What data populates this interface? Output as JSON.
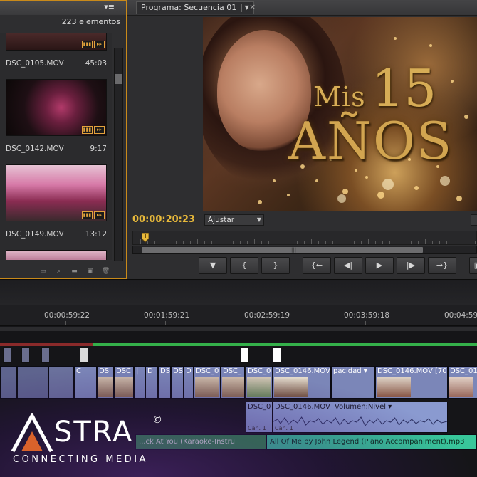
{
  "project_panel": {
    "menu_icon": "panel-menu-icon",
    "item_count": "223 elementos",
    "clips": [
      {
        "name": "DSC_0105.MOV",
        "duration": "45:03"
      },
      {
        "name": "DSC_0142.MOV",
        "duration": "9:17"
      },
      {
        "name": "DSC_0149.MOV",
        "duration": "13:12"
      }
    ],
    "footer_icons": [
      "list-view-icon",
      "search-icon",
      "new-bin-icon",
      "new-item-icon",
      "delete-icon"
    ]
  },
  "program_monitor": {
    "tab_label": "Programa: Secuencia 01",
    "close_glyph": "×",
    "viewer_title": {
      "line1_word": "Mis",
      "line1_number": "15",
      "line2": "AÑOS"
    },
    "timecode": "00:00:20:23",
    "fit_select": "Ajustar",
    "transport_buttons": [
      "marker-icon",
      "mark-in-icon",
      "mark-out-icon",
      "go-to-in-icon",
      "step-back-icon",
      "play-icon",
      "step-forward-icon",
      "go-to-out-icon"
    ],
    "transport_glyphs": [
      "▼",
      "{",
      "}",
      "{←",
      "◀|",
      "▶",
      "|▶",
      "→}"
    ]
  },
  "timeline": {
    "ruler_labels": [
      "00:00:59:22",
      "00:01:59:21",
      "00:02:59:19",
      "00:03:59:18",
      "00:04:59"
    ],
    "video_clips": [
      {
        "label": "DSC_0"
      },
      {
        "label": "DSC_0146.MOV"
      },
      {
        "label": "pacidad ▾"
      },
      {
        "label": "DSC_0146.MOV [70"
      },
      {
        "label": "DSC_01"
      }
    ],
    "small_video_labels": [
      "C",
      "DS",
      "DSC",
      "D",
      "DS",
      "DS",
      "D",
      "DSC_0",
      "DSC_"
    ],
    "audio_clips": [
      {
        "label": "DSC_0",
        "channel": "Can. 1"
      },
      {
        "label": "DSC_0146.MOV",
        "channel": "Can. 1"
      },
      {
        "label": "Volumen:Nivel ▾",
        "channel": ""
      }
    ],
    "music_clips": [
      {
        "label": "...ck At You (Karaoke-Instru"
      },
      {
        "label": "All Of Me by John Legend (Piano Accompaniment).mp3"
      }
    ]
  },
  "logo": {
    "brand": "STRA",
    "registered": "©",
    "tagline": "CONNECTING MEDIA"
  },
  "colors": {
    "accent_timecode": "#e8b93a",
    "panel_border_active": "#c98a1a",
    "video_clip": "#7b86b8",
    "audio_clip": "#8a9ad0",
    "music_clip": "#38c79a",
    "work_bar": "#34b04a"
  }
}
